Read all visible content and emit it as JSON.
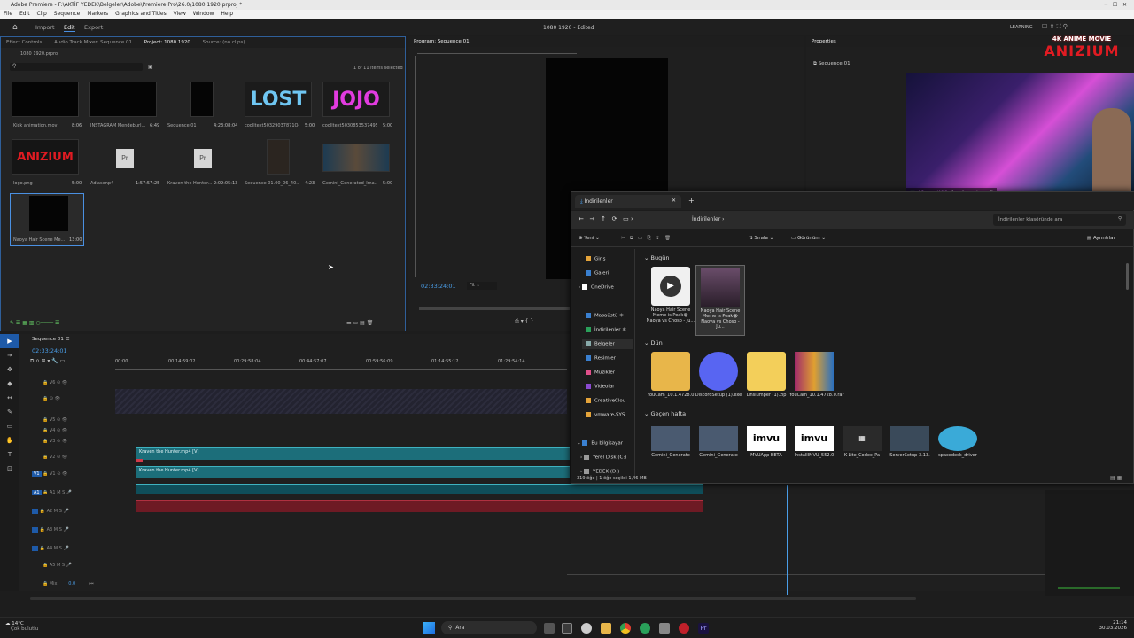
{
  "app": {
    "title": "Adobe Premiere - F:\\AKTİF YEDEK\\Belgeler\\Adobe\\Premiere Pro\\26.0\\1080 1920.prproj *",
    "menu": [
      "File",
      "Edit",
      "Clip",
      "Sequence",
      "Markers",
      "Graphics and Titles",
      "View",
      "Window",
      "Help"
    ],
    "workspace_tabs": [
      "Import",
      "Edit",
      "Export"
    ],
    "project_status": "1080 1920 - Edited",
    "learning": "LEARNING"
  },
  "project_panel": {
    "tabs": [
      "Effect Controls",
      "Audio Track Mixer: Sequence 01",
      "Project: 1080 1920",
      "Source: (no clips)"
    ],
    "path": "1080 1920.prproj",
    "items_selected": "1 of 11 items selected",
    "items": [
      {
        "name": "Kick animation.mov",
        "duration": "8:06"
      },
      {
        "name": "INSTAGRAM Mendeburl...",
        "duration": "6:49"
      },
      {
        "name": "Sequence 01",
        "duration": "4:23:08:04"
      },
      {
        "name": "coolltext50329037871O4...",
        "duration": "5:00",
        "thumb_text": "LOST"
      },
      {
        "name": "coolltext5030853537495...",
        "duration": "5:00",
        "thumb_text": "JOJO"
      },
      {
        "name": "logo.png",
        "duration": "5:00",
        "thumb_text": "ANIZIUM"
      },
      {
        "name": "Adlasımp4",
        "duration": "1:57:57:25",
        "thumb_text": "Pr"
      },
      {
        "name": "Kraven the Hunter...",
        "duration": "2:09:05:13",
        "thumb_text": "Pr"
      },
      {
        "name": "Sequence 01.00_06_40...",
        "duration": "4:23"
      },
      {
        "name": "Gemini_Generated_Ima...",
        "duration": "5:00"
      },
      {
        "name": "Naoya Hair Scene Me...",
        "duration": "13:00"
      }
    ]
  },
  "program_monitor": {
    "tab": "Program: Sequence 01",
    "timecode": "02:33:24:01",
    "fit": "Fit"
  },
  "properties": {
    "tab": "Properties",
    "sequence": "Sequence 01"
  },
  "overlay": {
    "brand_top": "4K ANIME MOVIE",
    "brand_main": "ANIZIUM",
    "chat_user": "49musti09",
    "chat_text": ": beyin yetmedi"
  },
  "timeline": {
    "tab": "Sequence 01",
    "timecode": "02:33:24:01",
    "ruler": [
      "00:00",
      "00:14:59:02",
      "00:29:58:04",
      "00:44:57:07",
      "00:59:56:09",
      "01:14:55:12",
      "01:29:54:14"
    ],
    "video_tracks": [
      "V6",
      "V5",
      "V4",
      "V3",
      "V2",
      "V1"
    ],
    "audio_tracks": [
      "A1",
      "A2",
      "A3",
      "A4",
      "A5"
    ],
    "clip_v2": "Kraven the Hunter.mp4 [V]",
    "clip_v1": "Kraven the Hunter.mp4 [V]",
    "mix": "Mix",
    "mix_value": "0.0"
  },
  "explorer": {
    "tab": "İndirilenler",
    "breadcrumb": "İndirilenler",
    "search_placeholder": "İndirilenler klasöründe ara",
    "toolbar": {
      "new": "Yeni",
      "sort": "Sırala",
      "view": "Görünüm",
      "details": "Ayrıntılar"
    },
    "sidebar": [
      "Giriş",
      "Galeri",
      "OneDrive",
      "Masaüstü",
      "İndirilenler",
      "Belgeler",
      "Resimler",
      "Müzikler",
      "Videolar",
      "CreativeClou",
      "vmware-SYS",
      "Bu bilgisayar",
      "Yerel Disk (C:)",
      "YEDEK (D:)"
    ],
    "groups": {
      "today": "Bugün",
      "yesterday": "Dün",
      "last_week": "Geçen hafta"
    },
    "files_today": [
      {
        "name": "Naoya Hair Scene Meme is Peak😭 Naoya vs Choso - Ju..."
      },
      {
        "name": "Naoya Hair Scene Meme is Peak😭 Naoya vs Choso - Ju..."
      }
    ],
    "files_yesterday": [
      {
        "name": "YouCam_10.1.4728.0"
      },
      {
        "name": "DiscordSetup (1).exe"
      },
      {
        "name": "Dnslumper (1).zip"
      },
      {
        "name": "YouCam_10.1.4728.0.rar"
      }
    ],
    "files_lastweek": [
      {
        "name": "Gemini_Generate"
      },
      {
        "name": "Gemini_Generate"
      },
      {
        "name": "IMVUApp-BETA-"
      },
      {
        "name": "InstallIMVU_552.0"
      },
      {
        "name": "K-Lite_Codec_Pa"
      },
      {
        "name": "ServerSetup-3.13."
      },
      {
        "name": "spacedesk_driver"
      }
    ],
    "status": "319 öğe  |  1 öğe seçildi 1,46 MB  |"
  },
  "taskbar": {
    "weather_temp": "14°C",
    "weather_desc": "Çok bulutlu",
    "search": "Ara",
    "time": "21:14",
    "date": "30.03.2026"
  }
}
